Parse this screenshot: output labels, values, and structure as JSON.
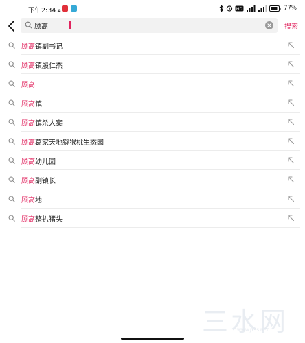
{
  "status_bar": {
    "time": "下午2:34",
    "network_marker": "#",
    "battery": "77%"
  },
  "search": {
    "value": "顾高",
    "submit_label": "搜索"
  },
  "suggestions": [
    {
      "highlight": "顾高",
      "rest": "镇副书记"
    },
    {
      "highlight": "顾高",
      "rest": "镇殷仁杰"
    },
    {
      "highlight": "顾高",
      "rest": ""
    },
    {
      "highlight": "顾高",
      "rest": "镇"
    },
    {
      "highlight": "顾高",
      "rest": "镇杀人案"
    },
    {
      "highlight": "顾高",
      "rest": "葛家天地猕猴桃生态园"
    },
    {
      "highlight": "顾高",
      "rest": "幼儿园"
    },
    {
      "highlight": "顾高",
      "rest": "副镇长"
    },
    {
      "highlight": "顾高",
      "rest": "地"
    },
    {
      "highlight": "顾高",
      "rest": "整扒猪头"
    }
  ],
  "watermark": {
    "text": "三水网",
    "url": "WWW.JYSS.NET"
  },
  "colors": {
    "accent": "#e0245e",
    "search_bg": "#f2f2f2",
    "text": "#222222",
    "icon_gray": "#9a9a9a"
  },
  "icons": {
    "back": "chevron-left-icon",
    "search": "search-icon",
    "clear": "clear-icon",
    "fill": "arrow-up-left-icon"
  }
}
